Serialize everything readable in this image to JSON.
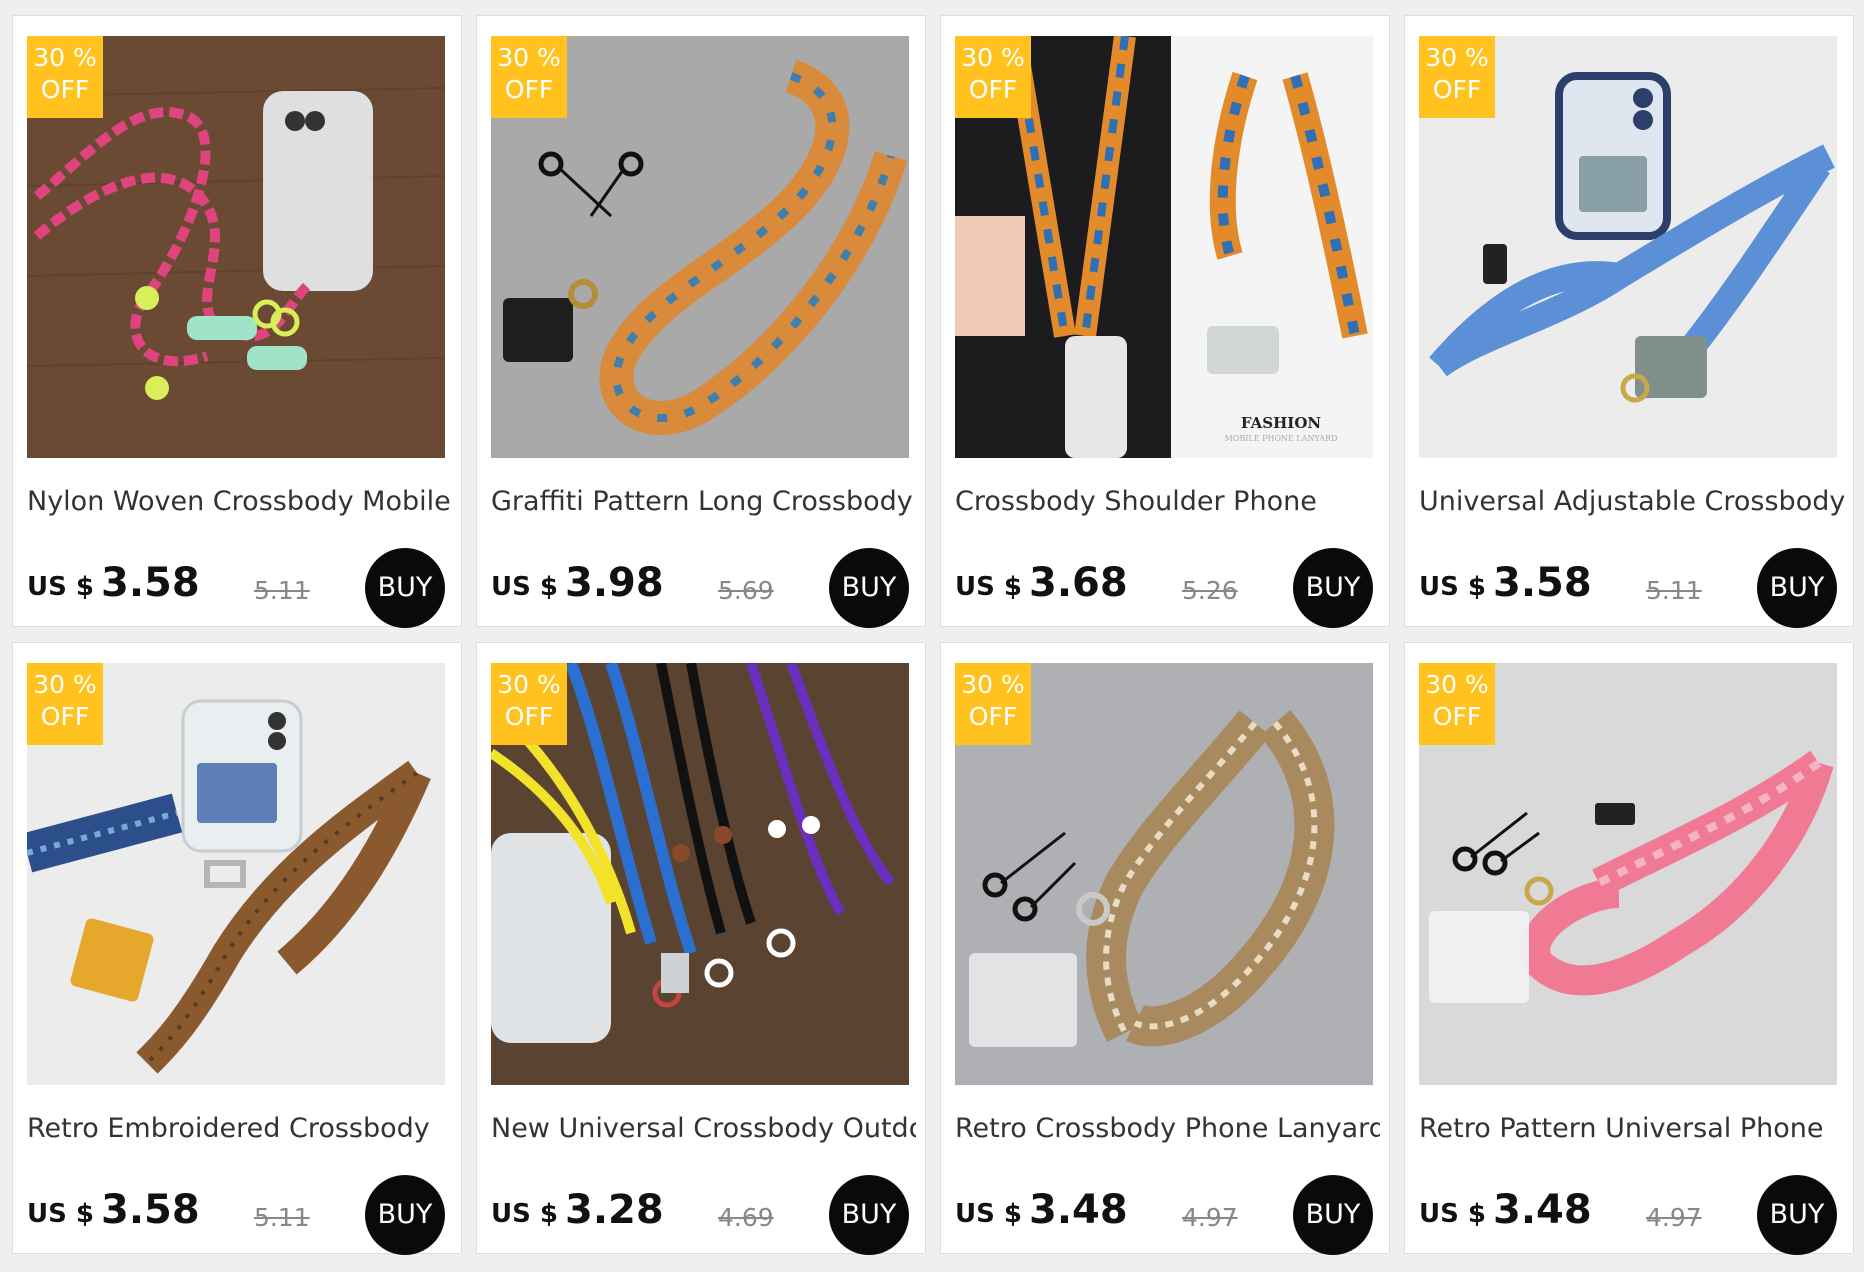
{
  "badge": {
    "line1": "30 %",
    "line2": "OFF"
  },
  "currency": "US $",
  "buy_label": "BUY",
  "products": [
    {
      "title": "Nylon Woven Crossbody Mobile",
      "price": "3.58",
      "original": "5.11",
      "image": {
        "bg": "#6b4a33",
        "accent": "#e0447e",
        "accent2": "#9fe3c8"
      }
    },
    {
      "title": "Graffiti Pattern Long Crossbody",
      "price": "3.98",
      "original": "5.69",
      "image": {
        "bg": "#a9a9aa",
        "accent": "#d98a3a",
        "accent2": "#3f7fb0"
      }
    },
    {
      "title": "Crossbody Shoulder Phone",
      "price": "3.68",
      "original": "5.26",
      "image": {
        "bg": "#f4f4f4",
        "accent": "#e38a2b",
        "accent2": "#2e6fb5",
        "caption": "FASHION",
        "caption2": "MOBILE PHONE LANYARD"
      }
    },
    {
      "title": "Universal Adjustable Crossbody",
      "price": "3.58",
      "original": "5.11",
      "image": {
        "bg": "#ececed",
        "accent": "#5b8fd6",
        "accent2": "#7f8f8c"
      }
    },
    {
      "title": "Retro Embroidered Crossbody",
      "price": "3.58",
      "original": "5.11",
      "image": {
        "bg": "#ececed",
        "accent": "#8a5a2e",
        "accent2": "#2c4f8c"
      }
    },
    {
      "title": "New Universal Crossbody Outdoo",
      "price": "3.28",
      "original": "4.69",
      "image": {
        "bg": "#5a4330",
        "accent": "#2b6fd0",
        "accent2": "#f2e229"
      }
    },
    {
      "title": "Retro Crossbody Phone Lanyard",
      "price": "3.48",
      "original": "4.97",
      "image": {
        "bg": "#aeb0b3",
        "accent": "#a88a5e",
        "accent2": "#e8dcc4"
      }
    },
    {
      "title": "Retro Pattern Universal Phone",
      "price": "3.48",
      "original": "4.97",
      "image": {
        "bg": "#d9d9da",
        "accent": "#f07a93",
        "accent2": "#f5b4c2"
      }
    }
  ]
}
